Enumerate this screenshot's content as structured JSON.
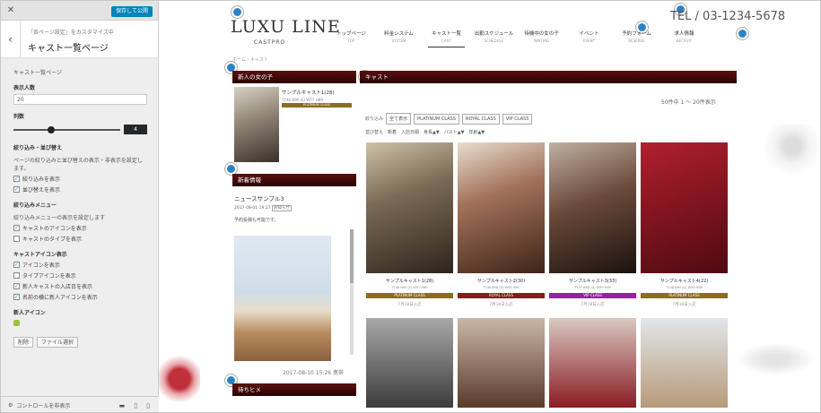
{
  "customizer": {
    "close": "✕",
    "publish": "保存して公開",
    "crumb": "「各ページ設定」をカスタマイズ中",
    "title": "キャスト一覧ページ",
    "section_label": "キャスト一覧ページ",
    "display_count_label": "表示人数",
    "display_count_value": "20",
    "columns_label": "列数",
    "columns_value": "4",
    "columns_fraction": 0.35,
    "filter_title": "絞り込み・並び替え",
    "filter_desc": "ページの絞り込みと並び替えの表示・非表示を設定します。",
    "filter_checks": [
      {
        "label": "絞り込みを表示",
        "checked": true
      },
      {
        "label": "並び替えを表示",
        "checked": true
      }
    ],
    "menu_title": "絞り込みメニュー",
    "menu_desc": "絞り込みメニューの表示を設定します",
    "menu_checks": [
      {
        "label": "キャストのアイコンを表示",
        "checked": true
      },
      {
        "label": "キャストのタイプを表示",
        "checked": false
      }
    ],
    "icon_title": "キャストアイコン表示",
    "icon_checks": [
      {
        "label": "アイコンを表示",
        "checked": true
      },
      {
        "label": "タイプアイコンを表示",
        "checked": false
      },
      {
        "label": "新人キャストの入店日を表示",
        "checked": true
      },
      {
        "label": "名前の横に新人アイコンを表示",
        "checked": true
      }
    ],
    "new_icon_title": "新人アイコン",
    "remove_btn": "削除",
    "select_btn": "ファイル選択",
    "footer_label": "コントロールを非表示"
  },
  "site": {
    "logo": "LUXU LINE",
    "logo_sub": "CASTPRO",
    "tel": "TEL / 03-1234-5678",
    "breadcrumb": "ホーム › キャスト",
    "nav": [
      {
        "jp": "トップページ",
        "en": "TOP",
        "active": false
      },
      {
        "jp": "料金システム",
        "en": "SYSTEM",
        "active": false
      },
      {
        "jp": "キャスト一覧",
        "en": "CAST",
        "active": true
      },
      {
        "jp": "出勤スケジュール",
        "en": "SCHEDULE",
        "active": false
      },
      {
        "jp": "待機中の女の子",
        "en": "WAITING",
        "active": false
      },
      {
        "jp": "イベント",
        "en": "EVENT",
        "active": false
      },
      {
        "jp": "予約フォーム",
        "en": "RESERVE",
        "active": false
      },
      {
        "jp": "求人情報",
        "en": "RECRUIT",
        "active": false
      }
    ],
    "new_girl_title": "新人の女の子",
    "new_girl": {
      "name": "サンプルキャスト1(28)",
      "meas": "T148 B90 (E) W57 H89",
      "badge": "PLATINUM CLASS"
    },
    "news_title": "新着情報",
    "news_item_title": "ニュースサンプル3",
    "news_item_date": "2017-08-01 19:27",
    "news_item_tag": "お知らせ",
    "news_item_text": "予約投稿も可能です。",
    "bottom_bar": "待ちヒメ",
    "bottom_date": "2017-08-10 15:26 携帯",
    "list_title": "キャスト",
    "count": "50件中 1 ～ 20件表示",
    "filter_label": "絞り込み",
    "filter_buttons": [
      "全て表示",
      "PLATINUM CLASS",
      "ROYAL CLASS",
      "VIP CLASS"
    ],
    "sort_items": [
      "並び替え",
      "新着",
      "入店日順",
      "身長▲▼",
      "バスト▲▼",
      "年齢▲▼"
    ],
    "casts": [
      {
        "name": "サンプルキャスト1(28)",
        "meas": "T148 B90 (E) W57 H89",
        "badge": "PLATINUM CLASS",
        "badge_color": "#8a6d1e",
        "date": "7月18日入店"
      },
      {
        "name": "サンプルキャスト2(30)",
        "meas": "T148 B88 (D) W59 H84",
        "badge": "ROYAL CLASS",
        "badge_color": "#8b1a1a",
        "date": "7月18日入店"
      },
      {
        "name": "サンプルキャスト3(33)",
        "meas": "T157 B88 (D) W59 H89",
        "badge": "VIP CLASS",
        "badge_color": "#9b1ea8",
        "date": "7月18日入店"
      },
      {
        "name": "サンプルキャスト4(22)",
        "meas": "T148 B90 (G) W58 H88",
        "badge": "PLATINUM CLASS",
        "badge_color": "#8a6d1e",
        "date": "7月18日入店"
      }
    ]
  }
}
